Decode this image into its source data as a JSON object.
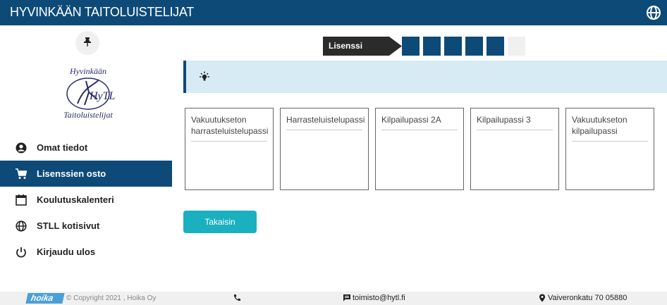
{
  "app": {
    "title": "HYVINKÄÄN TAITOLUISTELIJAT"
  },
  "colors": {
    "brand": "#0d4a78",
    "accent": "#1ab0bf",
    "notice_bg": "#d6ebf3"
  },
  "logo": {
    "alt_text": "Hyvinkään Taitoluistelijat"
  },
  "sidebar": {
    "items": [
      {
        "label": "Omat tiedot",
        "icon": "user-circle-icon",
        "active": false
      },
      {
        "label": "Lisenssien osto",
        "icon": "cart-icon",
        "active": true
      },
      {
        "label": "Koulutuskalenteri",
        "icon": "calendar-icon",
        "active": false
      },
      {
        "label": "STLL kotisivut",
        "icon": "globe-icon",
        "active": false
      },
      {
        "label": "Kirjaudu ulos",
        "icon": "power-icon",
        "active": false
      }
    ]
  },
  "steps": {
    "label": "Lisenssi",
    "filled": 5,
    "total": 6
  },
  "cards": [
    {
      "title": "Vakuutukseton harrasteluistelupassi"
    },
    {
      "title": "Harrasteluistelupassi"
    },
    {
      "title": "Kilpailupassi 2A"
    },
    {
      "title": "Kilpailupassi 3"
    },
    {
      "title": "Vakuutukseton kilpailupassi"
    }
  ],
  "back_button": {
    "label": "Takaisin"
  },
  "footer": {
    "brand": "hoika",
    "copyright": "© Copyright 2021 , Hoika Oy",
    "email": "toimisto@hytl.fi",
    "address": "Vaiveronkatu 70 05880"
  }
}
